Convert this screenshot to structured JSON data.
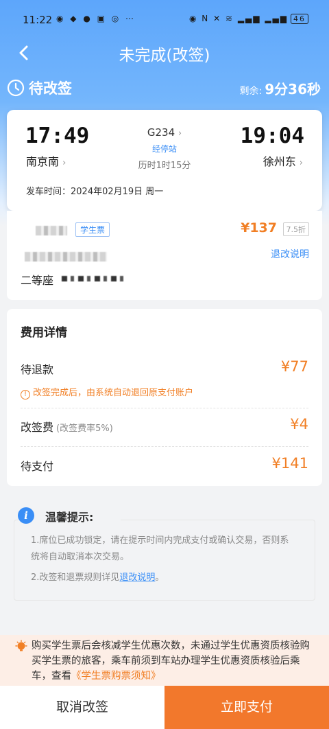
{
  "status_bar": {
    "time": "11:22",
    "left_icons_text": "◉ ◆ ● ▣ ◎ ⋯",
    "right_icons_text": "◉ N ✕ ≋ ▂▄▆ ▂▄▆",
    "battery": "46"
  },
  "nav": {
    "title": "未完成(改签)"
  },
  "status": {
    "label": "待改签",
    "remaining_label": "剩余:",
    "remaining_value": "9分36秒"
  },
  "trip": {
    "departure_time": "17:49",
    "arrival_time": "19:04",
    "departure_station": "南京南",
    "arrival_station": "徐州东",
    "train_number": "G234",
    "stops_link": "经停站",
    "duration": "历时1时15分",
    "departure_date": "发车时间：2024年02月19日 周一"
  },
  "passenger": {
    "ticket_type": "学生票",
    "price": "¥137",
    "discount": "7.5折",
    "refund_link": "退改说明",
    "seat_class": "二等座"
  },
  "fees": {
    "title": "费用详情",
    "pending_refund_label": "待退款",
    "pending_refund_value": "¥77",
    "refund_note": "改签完成后，由系统自动退回原支付账户",
    "change_fee_label": "改签费",
    "change_fee_rate": "(改签费率5%)",
    "change_fee_value": "¥4",
    "to_pay_label": "待支付",
    "to_pay_value": "¥141"
  },
  "tips": {
    "title": "温馨提示:",
    "tip1": "1.席位已成功锁定，请在提示时间内完成支付或确认交易，否则系统将自动取消本次交易。",
    "tip2_prefix": "2.改签和退票规则详见",
    "tip2_link": "退改说明",
    "tip2_suffix": "。"
  },
  "notice": {
    "text": "购买学生票后会核减学生优惠次数，未通过学生优惠资质核验购买学生票的旅客，乘车前须到车站办理学生优惠资质核验后乘车，查看",
    "link": "《学生票购票须知》"
  },
  "actions": {
    "cancel": "取消改签",
    "pay": "立即支付"
  },
  "colors": {
    "primary_blue": "#5da6fb",
    "accent_orange": "#f17f25",
    "link_blue": "#3a8ef6"
  }
}
